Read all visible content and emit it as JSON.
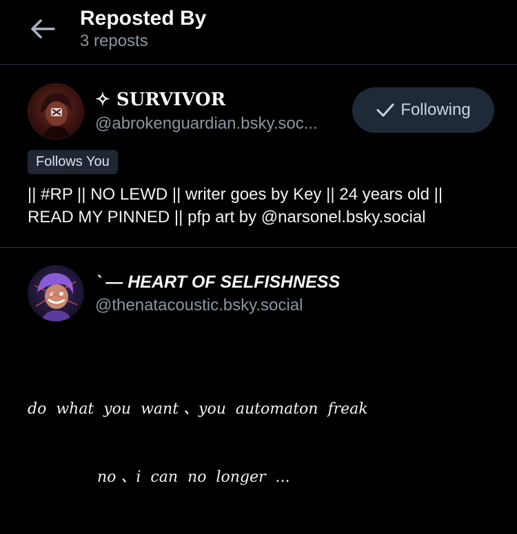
{
  "header": {
    "title": "Reposted By",
    "subtitle": "3 reposts"
  },
  "users": [
    {
      "name": "✧ SURVIVOR",
      "handle": "@abrokenguardian.bsky.soc...",
      "follow_button_label": "Following",
      "follows_you_label": "Follows You",
      "bio_lines": [
        "|| #RP || NO LEWD || writer goes by Key || 24 years old ||",
        "READ MY PINNED || pfp art by @narsonel.bsky.social"
      ]
    },
    {
      "name": "` — HEART OF SELFISHNESS",
      "handle": "@thenatacoustic.bsky.social",
      "bio_lines": [
        "do  what  you  want 、you  automaton  freak",
        "no 、i  can  no  longer  ..."
      ]
    }
  ],
  "colors": {
    "background": "#000000",
    "divider": "#2e3440",
    "muted_text": "#8b95a3",
    "button_bg": "#1f2a38",
    "badge_bg": "#1e2733"
  },
  "icons": {
    "back": "arrow-left-icon",
    "following": "checkmark-icon"
  }
}
